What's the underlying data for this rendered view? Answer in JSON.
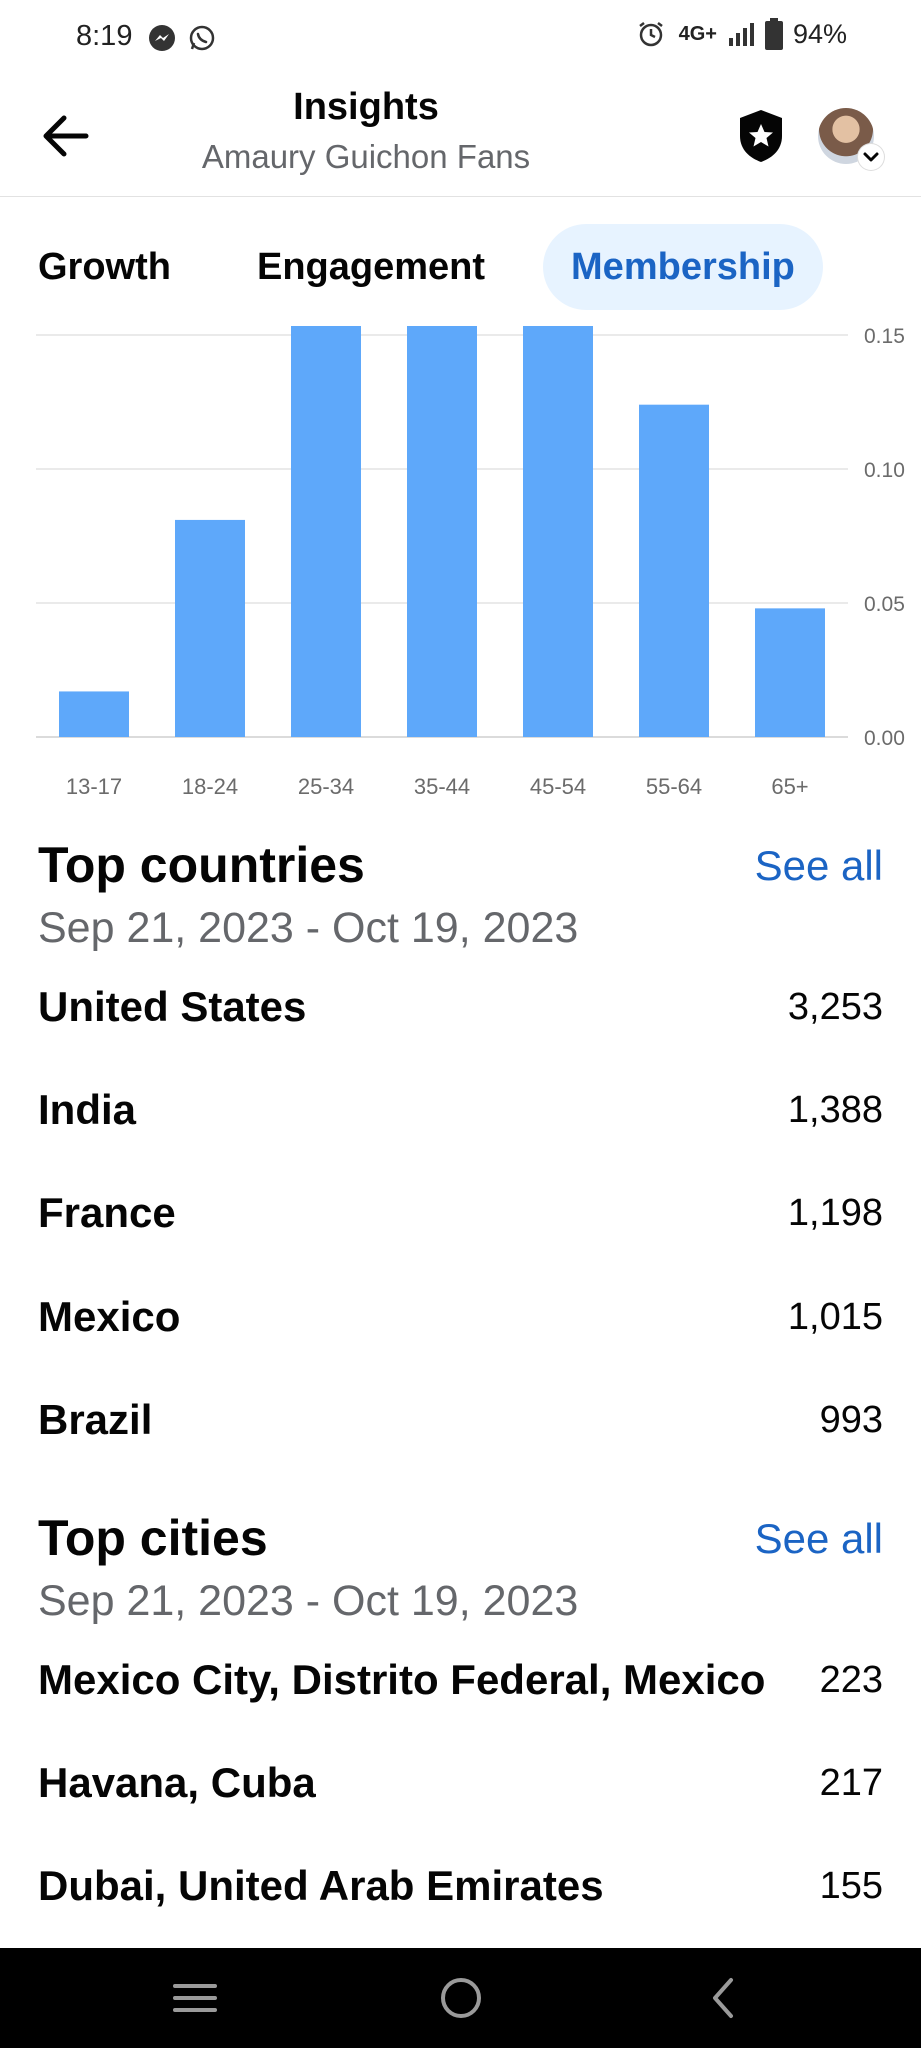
{
  "status_bar": {
    "time": "8:19",
    "network": "4G+",
    "battery": "94%",
    "icons": [
      "messenger-icon",
      "whatsapp-icon",
      "alarm-icon",
      "signal-icon",
      "battery-icon"
    ]
  },
  "header": {
    "title": "Insights",
    "subtitle": "Amaury Guichon Fans",
    "icons": [
      "back-arrow-icon",
      "shield-star-icon",
      "avatar",
      "chevron-down-icon"
    ]
  },
  "tabs": [
    {
      "label": "Growth",
      "active": false
    },
    {
      "label": "Engagement",
      "active": false
    },
    {
      "label": "Membership",
      "active": true
    }
  ],
  "chart_data": {
    "type": "bar",
    "categories": [
      "13-17",
      "18-24",
      "25-34",
      "35-44",
      "45-54",
      "55-64",
      "65+"
    ],
    "values": [
      0.017,
      0.081,
      0.155,
      0.155,
      0.155,
      0.124,
      0.048
    ],
    "y_ticks": [
      "0.00",
      "0.05",
      "0.10",
      "0.15"
    ],
    "ylim": [
      0,
      0.15
    ],
    "grid": true,
    "y_axis_position": "right",
    "bar_color": "#5ea8fa"
  },
  "top_countries": {
    "title": "Top countries",
    "see_all": "See all",
    "date_range": "Sep 21, 2023 - Oct 19, 2023",
    "rows": [
      {
        "name": "United States",
        "value": "3,253"
      },
      {
        "name": "India",
        "value": "1,388"
      },
      {
        "name": "France",
        "value": "1,198"
      },
      {
        "name": "Mexico",
        "value": "1,015"
      },
      {
        "name": "Brazil",
        "value": "993"
      }
    ]
  },
  "top_cities": {
    "title": "Top cities",
    "see_all": "See all",
    "date_range": "Sep 21, 2023 - Oct 19, 2023",
    "rows": [
      {
        "name": "Mexico City, Distrito Federal, Mexico",
        "value": "223"
      },
      {
        "name": "Havana, Cuba",
        "value": "217"
      },
      {
        "name": "Dubai, United Arab Emirates",
        "value": "155"
      }
    ]
  },
  "colors": {
    "accent": "#1b64c4",
    "active_tab_bg": "#e7f3ff",
    "secondary_text": "#65676b",
    "bar": "#5ea8fa"
  },
  "nav_bar": {
    "icons": [
      "recent-apps-icon",
      "home-icon",
      "back-icon"
    ]
  }
}
